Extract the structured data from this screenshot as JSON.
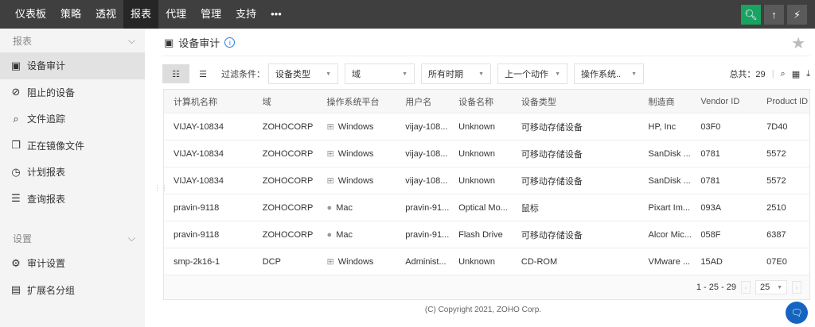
{
  "nav": {
    "items": [
      "仪表板",
      "策略",
      "透视",
      "报表",
      "代理",
      "管理",
      "支持",
      "•••"
    ],
    "active": 3
  },
  "sidebar": {
    "reports_label": "报表",
    "report_items": [
      {
        "label": "设备审计",
        "icon": "mobile-device-icon"
      },
      {
        "label": "阻止的设备",
        "icon": "blocked-icon"
      },
      {
        "label": "文件追踪",
        "icon": "file-search-icon"
      },
      {
        "label": "正在镜像文件",
        "icon": "mirror-file-icon"
      },
      {
        "label": "计划报表",
        "icon": "clock-icon"
      },
      {
        "label": "查询报表",
        "icon": "database-icon"
      }
    ],
    "settings_label": "设置",
    "settings_items": [
      {
        "label": "审计设置",
        "icon": "settings-icon"
      },
      {
        "label": "扩展名分组",
        "icon": "extension-icon"
      }
    ]
  },
  "page": {
    "title": "设备审计"
  },
  "toolbar": {
    "filter_label": "过滤条件：",
    "filters": [
      "设备类型",
      "域",
      "所有时期",
      "上一个动作",
      "操作系统.."
    ],
    "total": "总共：29"
  },
  "table": {
    "columns": [
      "计算机名称",
      "域",
      "操作系统平台",
      "用户名",
      "设备名称",
      "设备类型",
      "制造商",
      "Vendor ID",
      "Product ID"
    ],
    "rows": [
      [
        "VIJAY-10834",
        "ZOHOCORP",
        "Windows",
        "vijay-108...",
        "Unknown",
        "可移动存储设备",
        "HP, Inc",
        "03F0",
        "7D40"
      ],
      [
        "VIJAY-10834",
        "ZOHOCORP",
        "Windows",
        "vijay-108...",
        "Unknown",
        "可移动存储设备",
        "SanDisk ...",
        "0781",
        "5572"
      ],
      [
        "VIJAY-10834",
        "ZOHOCORP",
        "Windows",
        "vijay-108...",
        "Unknown",
        "可移动存储设备",
        "SanDisk ...",
        "0781",
        "5572"
      ],
      [
        "pravin-9118",
        "ZOHOCORP",
        "Mac",
        "pravin-91...",
        "Optical Mo...",
        "鼠标",
        "Pixart Im...",
        "093A",
        "2510"
      ],
      [
        "pravin-9118",
        "ZOHOCORP",
        "Mac",
        "pravin-91...",
        "Flash Drive",
        "可移动存储设备",
        "Alcor Mic...",
        "058F",
        "6387"
      ],
      [
        "smp-2k16-1",
        "DCP",
        "Windows",
        "Administ...",
        "Unknown",
        "CD-ROM",
        "VMware ...",
        "15AD",
        "07E0"
      ]
    ]
  },
  "pagination": {
    "range": "1 - 25 - 29",
    "per_page": "25"
  },
  "footer": {
    "copyright": "(C) Copyright 2021, ZOHO Corp."
  }
}
